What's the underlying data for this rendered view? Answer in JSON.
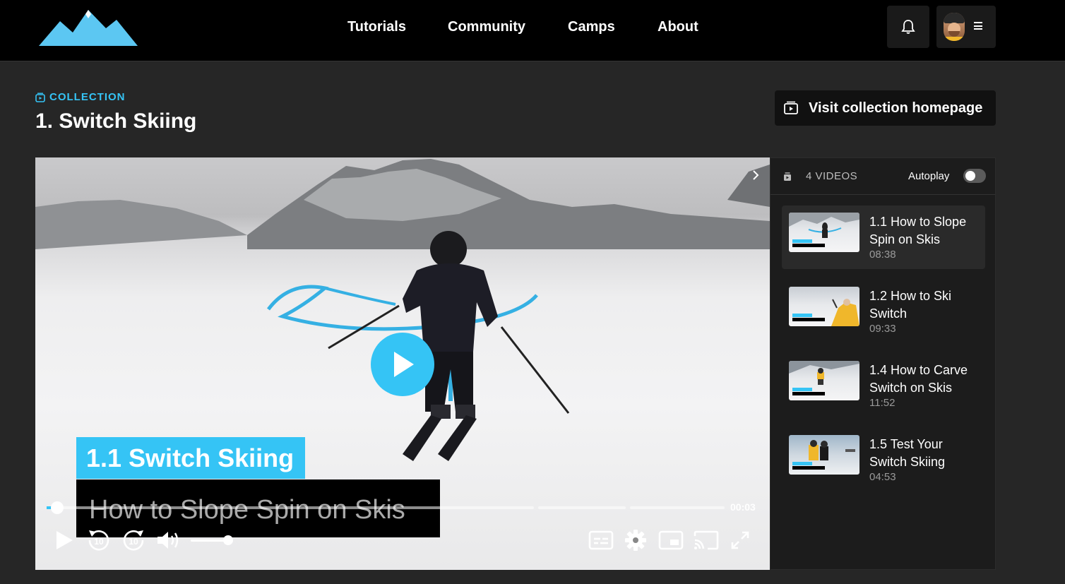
{
  "nav": {
    "items": [
      {
        "label": "Tutorials"
      },
      {
        "label": "Community"
      },
      {
        "label": "Camps"
      },
      {
        "label": "About"
      }
    ]
  },
  "collection": {
    "label": "COLLECTION",
    "title": "1. Switch Skiing",
    "visit_label": "Visit collection homepage"
  },
  "video": {
    "overlay_title": "1.1 Switch Skiing",
    "overlay_subtitle": "How to Slope Spin on Skis",
    "current_time": "00:03",
    "progress_fraction": 0.005
  },
  "playlist": {
    "count_label": "4 VIDEOS",
    "autoplay_label": "Autoplay",
    "autoplay_on": false,
    "items": [
      {
        "title": "1.1 How to Slope Spin on Skis",
        "duration": "08:38",
        "active": true
      },
      {
        "title": "1.2 How to Ski Switch",
        "duration": "09:33",
        "active": false
      },
      {
        "title": "1.4 How to Carve Switch on Skis",
        "duration": "11:52",
        "active": false
      },
      {
        "title": "1.5 Test Your Switch Skiing",
        "duration": "04:53",
        "active": false
      }
    ]
  },
  "colors": {
    "accent": "#35c4f5",
    "header_bg": "#000000",
    "page_bg": "#262626",
    "sidebar_bg": "#1c1c1c"
  },
  "icons": {
    "logo": "mountain-logo",
    "notifications": "bell-icon",
    "menu": "hamburger-icon",
    "collection": "collection-icon",
    "play": "play-icon",
    "rewind": "rewind-10-icon",
    "forward": "forward-10-icon",
    "volume": "volume-icon",
    "captions": "captions-icon",
    "settings": "gear-icon",
    "pip": "picture-in-picture-icon",
    "cast": "cast-icon",
    "fullscreen": "fullscreen-icon"
  }
}
